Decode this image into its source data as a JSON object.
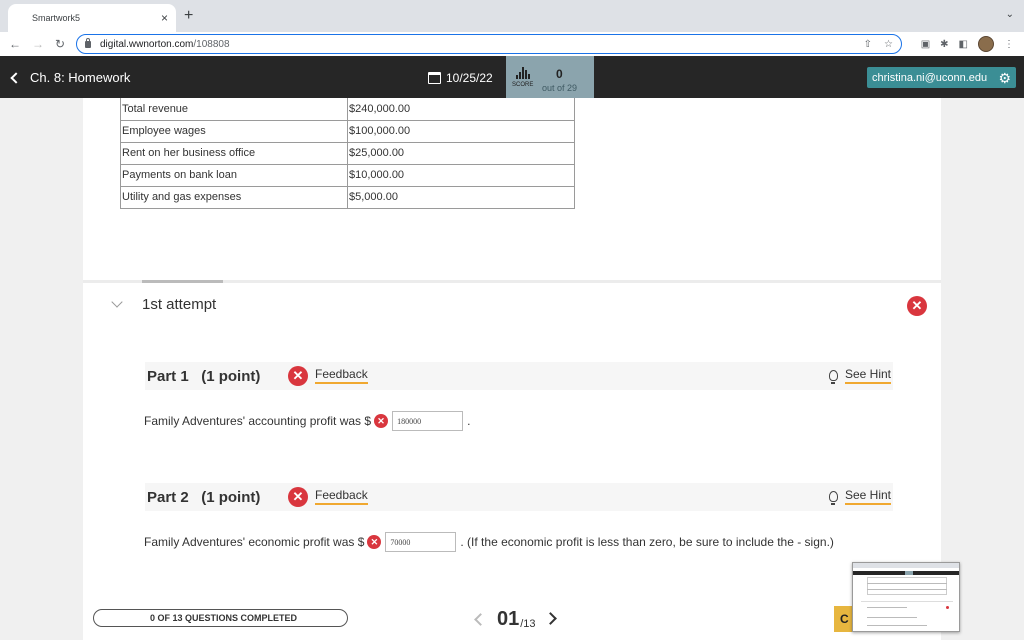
{
  "browser": {
    "tab_title": "Smartwork5",
    "tab_close": "×",
    "new_tab": "+",
    "url_host": "digital.wwnorton.com",
    "url_path": "/108808",
    "icons": [
      "back-icon",
      "forward-icon",
      "reload-icon",
      "lock-icon",
      "share-icon",
      "star-icon",
      "extensions-icon",
      "sidepanel-icon",
      "profile-avatar"
    ]
  },
  "header": {
    "back_label": "Ch. 8: Homework",
    "due_date": "10/25/22",
    "score_word": "SCORE",
    "score_value": "0",
    "score_total": "out of 29",
    "user_email": "christina.ni@uconn.edu",
    "colors": {
      "bar": "#262626",
      "score_bg": "#8ba4ad",
      "user_bg": "#3b8e95"
    }
  },
  "table": {
    "rows": [
      [
        "Total revenue",
        "$240,000.00"
      ],
      [
        "Employee wages",
        "$100,000.00"
      ],
      [
        "Rent on her business office",
        "$25,000.00"
      ],
      [
        "Payments on bank loan",
        "$10,000.00"
      ],
      [
        "Utility and gas expenses",
        "$5,000.00"
      ]
    ]
  },
  "attempt": {
    "title": "1st attempt",
    "status": "incorrect"
  },
  "parts": [
    {
      "title": "Part 1",
      "points": "(1 point)",
      "feedback_label": "Feedback",
      "hint_label": "See Hint",
      "prompt": "Family Adventures' accounting profit was $",
      "answer": "180000",
      "suffix": "."
    },
    {
      "title": "Part 2",
      "points": "(1 point)",
      "feedback_label": "Feedback",
      "hint_label": "See Hint",
      "prompt": "Family Adventures' economic profit was $",
      "answer": "70000",
      "suffix": ". (If the economic profit is less than zero, be sure to include the - sign.)"
    }
  ],
  "footer": {
    "progress_label": "0 OF 13 QUESTIONS COMPLETED",
    "current_page": "01",
    "total_pages": "/13",
    "check_label": "C"
  },
  "colors": {
    "error": "#d9363e",
    "link_underline": "#f0a830",
    "check_btn": "#e7b63f"
  }
}
